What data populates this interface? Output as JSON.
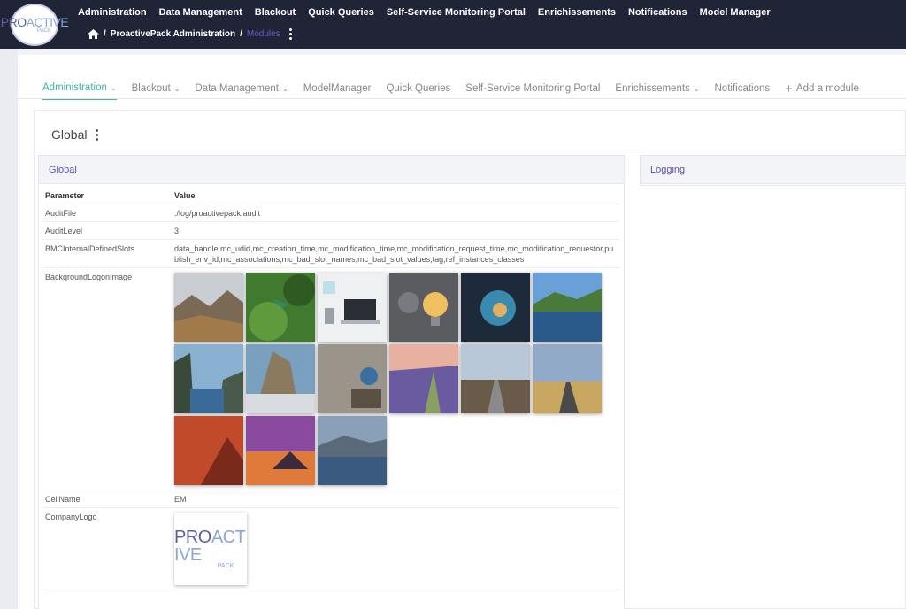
{
  "app": {
    "logo_main": "PRO",
    "logo_thin": "ACTIVE",
    "logo_sub": "PACK"
  },
  "topnav": {
    "items": [
      "Administration",
      "Data Management",
      "Blackout",
      "Quick Queries",
      "Self-Service Monitoring Portal",
      "Enrichissements",
      "Notifications",
      "Model Manager"
    ]
  },
  "breadcrumb": {
    "level1": "ProactivePack Administration",
    "current": "Modules"
  },
  "tabs": {
    "items": [
      {
        "label": "Administration"
      },
      {
        "label": "Blackout"
      },
      {
        "label": "Data Management"
      },
      {
        "label": "ModelManager"
      },
      {
        "label": "Quick Queries"
      },
      {
        "label": "Self-Service Monitoring Portal"
      },
      {
        "label": "Enrichissements"
      },
      {
        "label": "Notifications"
      }
    ],
    "add_label": "Add a module"
  },
  "section": {
    "title": "Global"
  },
  "global_card": {
    "title": "Global",
    "header_param": "Parameter",
    "header_value": "Value",
    "rows": [
      {
        "param": "AuditFile",
        "value": "./log/proactivepack.audit"
      },
      {
        "param": "AuditLevel",
        "value": "3"
      },
      {
        "param": "BMCInternalDefinedSlots",
        "value": "data_handle,mc_udid,mc_creation_time,mc_modification_time,mc_modification_request_time,mc_modification_requestor,publish_env_id,mc_associations,mc_bad_slot_names,mc_bad_slot_values,tag,ref_instances_classes"
      },
      {
        "param": "BackgroundLogonImage",
        "value": ""
      },
      {
        "param": "CellName",
        "value": "EM"
      },
      {
        "param": "CompanyLogo",
        "value": ""
      }
    ]
  },
  "logging_card": {
    "title": "Logging"
  },
  "colors": {
    "topbar": "#1f2436",
    "accent_teal": "#3fb6a0",
    "accent_purple": "#6a4fb3"
  }
}
